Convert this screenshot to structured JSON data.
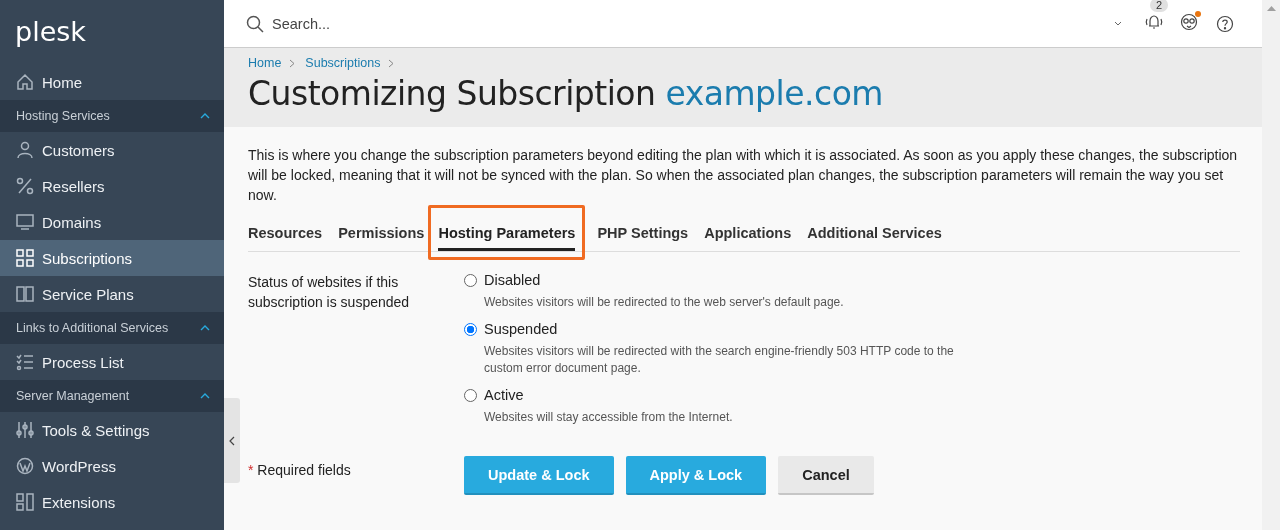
{
  "logo": "plesk",
  "sidebar": {
    "items": [
      {
        "kind": "item",
        "label": "Home",
        "selected": false
      },
      {
        "kind": "section",
        "label": "Hosting Services",
        "expanded": true
      },
      {
        "kind": "item",
        "label": "Customers",
        "selected": false
      },
      {
        "kind": "item",
        "label": "Resellers",
        "selected": false
      },
      {
        "kind": "item",
        "label": "Domains",
        "selected": false
      },
      {
        "kind": "item",
        "label": "Subscriptions",
        "selected": true
      },
      {
        "kind": "item",
        "label": "Service Plans",
        "selected": false
      },
      {
        "kind": "section",
        "label": "Links to Additional Services",
        "expanded": true
      },
      {
        "kind": "item",
        "label": "Process List",
        "selected": false
      },
      {
        "kind": "section",
        "label": "Server Management",
        "expanded": true
      },
      {
        "kind": "item",
        "label": "Tools & Settings",
        "selected": false
      },
      {
        "kind": "item",
        "label": "WordPress",
        "selected": false
      },
      {
        "kind": "item",
        "label": "Extensions",
        "selected": false
      }
    ]
  },
  "topbar": {
    "search": {
      "placeholder": "Search..."
    },
    "notifications": "2",
    "updates_dot": true
  },
  "breadcrumbs": [
    "Home",
    "Subscriptions"
  ],
  "title": {
    "text": "Customizing Subscription",
    "subject": "example.com"
  },
  "description": "This is where you change the subscription parameters beyond editing the plan with which it is associated. As soon as you apply these changes, the subscription will be locked, meaning that it will not be synced with the plan. So when the associated plan changes, the subscription parameters will remain the way you set now.",
  "tabs": [
    {
      "label": "Resources",
      "selected": false,
      "highlighted": false
    },
    {
      "label": "Permissions",
      "selected": false,
      "highlighted": false
    },
    {
      "label": "Hosting Parameters",
      "selected": true,
      "highlighted": true
    },
    {
      "label": "PHP Settings",
      "selected": false,
      "highlighted": false
    },
    {
      "label": "Applications",
      "selected": false,
      "highlighted": false
    },
    {
      "label": "Additional Services",
      "selected": false,
      "highlighted": false
    }
  ],
  "form": {
    "label": "Status of websites if this subscription is suspended",
    "options": [
      {
        "label": "Disabled",
        "hint": "Websites visitors will be redirected to the web server's default page.",
        "selected": false
      },
      {
        "label": "Suspended",
        "hint": "Websites visitors will be redirected with the search engine-friendly 503 HTTP code to the custom error document page.",
        "selected": true
      },
      {
        "label": "Active",
        "hint": "Websites will stay accessible from the Internet.",
        "selected": false
      }
    ]
  },
  "required_note": {
    "mark": "*",
    "text": "Required fields"
  },
  "buttons": [
    {
      "label": "Update & Lock",
      "kind": "primary"
    },
    {
      "label": "Apply & Lock",
      "kind": "primary"
    },
    {
      "label": "Cancel",
      "kind": "secondary"
    }
  ]
}
